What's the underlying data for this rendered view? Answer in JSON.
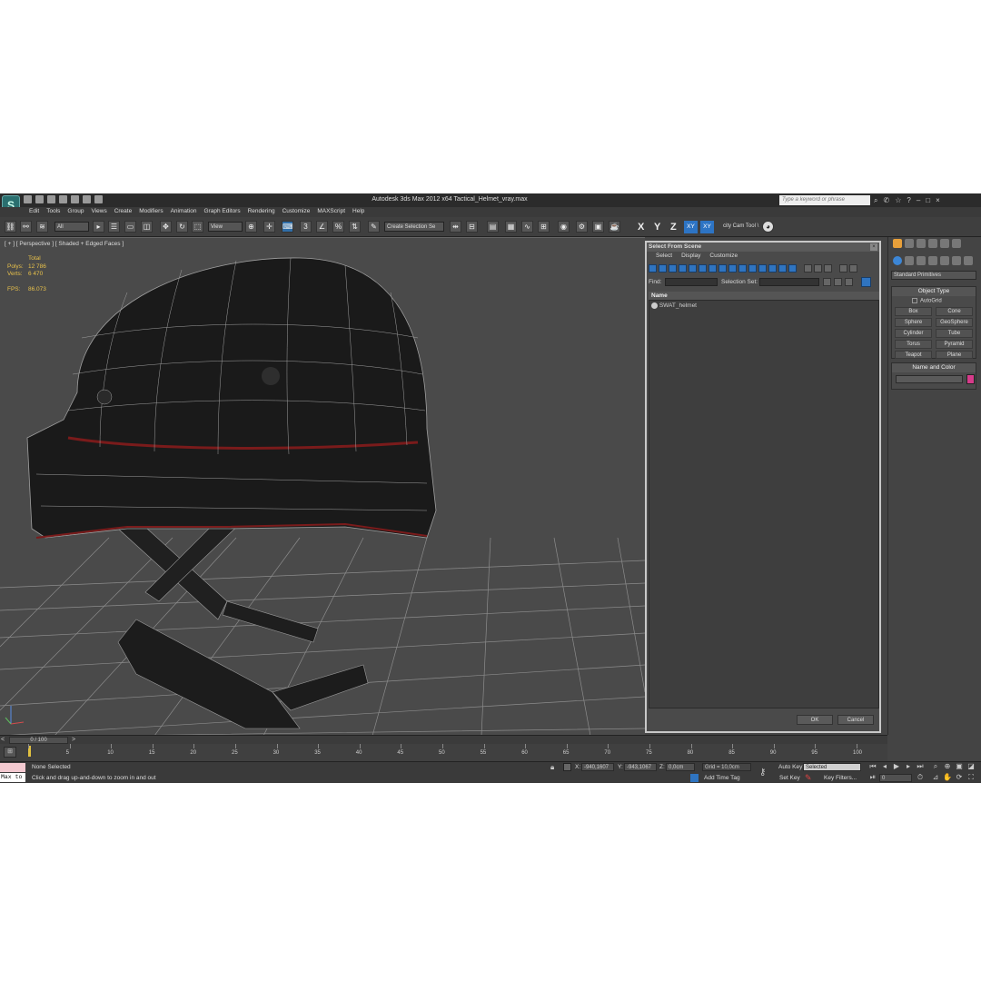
{
  "app": {
    "logo": "S",
    "title": "Autodesk 3ds Max  2012 x64    Tactical_Helmet_vray.max",
    "search_placeholder": "Type a keyword or phrase"
  },
  "menu": [
    "Edit",
    "Tools",
    "Group",
    "Views",
    "Create",
    "Modifiers",
    "Animation",
    "Graph Editors",
    "Rendering",
    "Customize",
    "MAXScript",
    "Help"
  ],
  "toolbar": {
    "filter_dropdown": "All",
    "refcoord_dropdown": "View",
    "angle_snap": "3",
    "selection_set_dropdown": "Create Selection Se",
    "axes": [
      "X",
      "Y",
      "Z"
    ],
    "axis_xy": "XY",
    "axis_xy2": "XY",
    "named_tool": "city Cam Tool \\"
  },
  "viewport": {
    "label": "[ + ] [ Perspective ] [ Shaded + Edged Faces ]",
    "stats_header": "Total",
    "polys_label": "Polys:",
    "polys_value": "12 786",
    "verts_label": "Verts:",
    "verts_value": "6 470",
    "fps_label": "FPS:",
    "fps_value": "86.073"
  },
  "dialog": {
    "title": "Select From Scene",
    "menu": [
      "Select",
      "Display",
      "Customize"
    ],
    "find_label": "Find:",
    "selection_set_label": "Selection Set:",
    "column_name": "Name",
    "items": [
      "SWAT_helmet"
    ],
    "ok": "OK",
    "cancel": "Cancel"
  },
  "command_panel": {
    "category_dropdown": "Standard Primitives",
    "object_type_title": "Object Type",
    "autogrid_label": "AutoGrid",
    "primitives": [
      "Box",
      "Cone",
      "Sphere",
      "GeoSphere",
      "Cylinder",
      "Tube",
      "Torus",
      "Pyramid",
      "Teapot",
      "Plane"
    ],
    "name_color_title": "Name and Color",
    "object_color": "#d63b8a"
  },
  "timeline": {
    "slider_label": "0 / 100",
    "ticks": [
      "0",
      "5",
      "10",
      "15",
      "20",
      "25",
      "30",
      "35",
      "40",
      "45",
      "50",
      "55",
      "60",
      "65",
      "70",
      "75",
      "80",
      "85",
      "90",
      "95",
      "100"
    ]
  },
  "status": {
    "maxscript_label": "Max to",
    "selection_text": "None Selected",
    "prompt": "Click and drag up-and-down to zoom in and out",
    "x_label": "X:",
    "x_value": "-940,1607",
    "y_label": "Y:",
    "y_value": "-943,1067",
    "z_label": "Z:",
    "z_value": "0,0cm",
    "grid": "Grid = 10,0cm",
    "add_time_tag": "Add Time Tag",
    "auto_key": "Auto Key",
    "set_key": "Set Key",
    "key_mode_dropdown": "Selected",
    "key_filters": "Key Filters...",
    "frame_value": "0"
  }
}
